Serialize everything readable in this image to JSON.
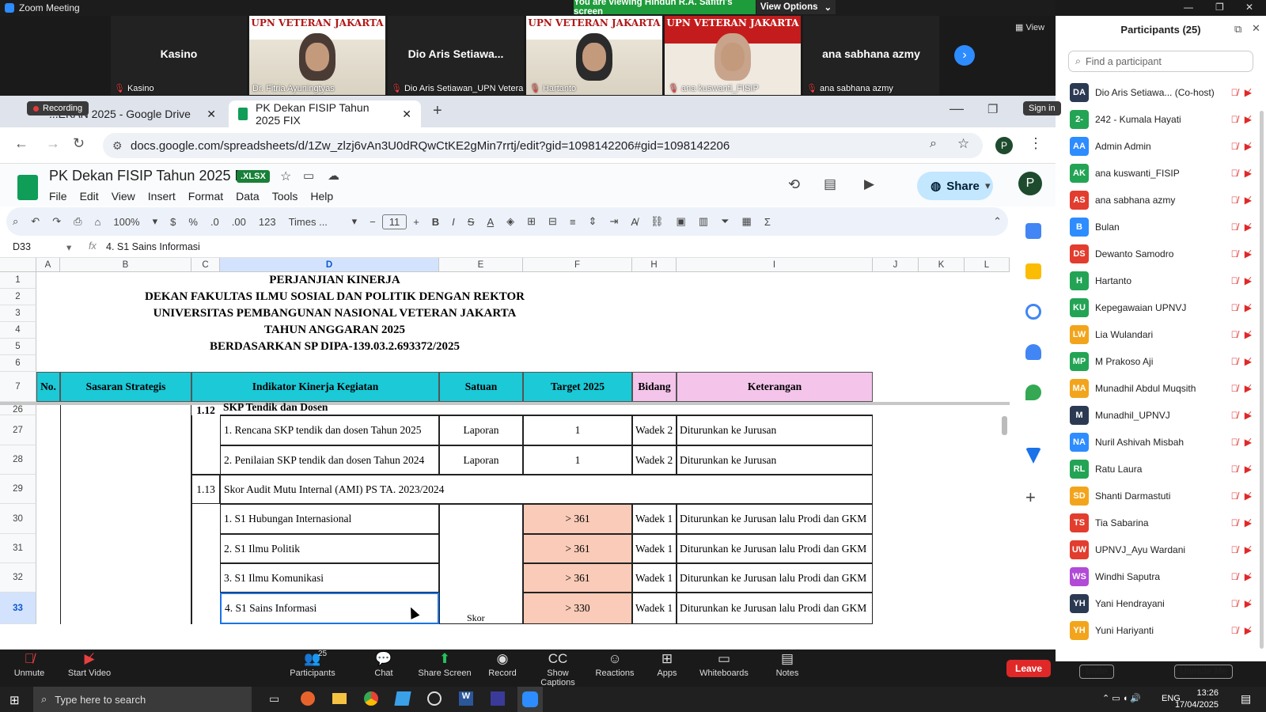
{
  "zoom": {
    "window_title": "Zoom Meeting",
    "viewing_banner": "You are viewing Hindun R.A. Safitri's screen",
    "view_options": "View Options",
    "view_label": "View",
    "recording_label": "Recording",
    "video_tiles": [
      {
        "type": "name",
        "name": "Kasino",
        "label": "Kasino"
      },
      {
        "type": "video",
        "banner": "UPN VETERAN JAKARTA",
        "label": "Dr. Fitria Ayuningtyas"
      },
      {
        "type": "name",
        "name": "Dio Aris Setiawa...",
        "label": "Dio Aris Setiawan_UPN Vetera..."
      },
      {
        "type": "video",
        "banner": "UPN VETERAN JAKARTA",
        "label": "Hartanto"
      },
      {
        "type": "video_red",
        "banner": "UPN VETERAN JAKARTA",
        "label": "ana kuswanti_FISIP"
      },
      {
        "type": "name",
        "name": "ana sabhana azmy",
        "label": "ana sabhana azmy"
      }
    ],
    "toolbar": [
      {
        "label": "Unmute",
        "icon": "mic-off-icon"
      },
      {
        "label": "Start Video",
        "icon": "video-off-icon"
      },
      {
        "label": "Participants",
        "icon": "participants-icon",
        "count": "25"
      },
      {
        "label": "Chat",
        "icon": "chat-icon"
      },
      {
        "label": "Share Screen",
        "icon": "share-screen-icon"
      },
      {
        "label": "Record",
        "icon": "record-icon"
      },
      {
        "label": "Show Captions",
        "icon": "captions-icon"
      },
      {
        "label": "Reactions",
        "icon": "reactions-icon"
      },
      {
        "label": "Apps",
        "icon": "apps-icon"
      },
      {
        "label": "Whiteboards",
        "icon": "whiteboard-icon"
      },
      {
        "label": "Notes",
        "icon": "notes-icon"
      }
    ],
    "leave_label": "Leave"
  },
  "participants": {
    "title": "Participants (25)",
    "search_placeholder": "Find a participant",
    "invite_label": "Invite",
    "unmute_me_label": "Unmute Me",
    "list": [
      {
        "initials": "DA",
        "name": "Dio Aris Setiawa... (Co-host)",
        "color": "#2b3a52"
      },
      {
        "initials": "2-",
        "name": "242 - Kumala Hayati",
        "color": "#23a455"
      },
      {
        "initials": "AA",
        "name": "Admin Admin",
        "color": "#2d8cff"
      },
      {
        "initials": "AK",
        "name": "ana kuswanti_FISIP",
        "color": "#23a455"
      },
      {
        "initials": "AS",
        "name": "ana sabhana azmy",
        "color": "#e23d2e"
      },
      {
        "initials": "B",
        "name": "Bulan",
        "color": "#2d8cff"
      },
      {
        "initials": "DS",
        "name": "Dewanto Samodro",
        "color": "#e23d2e"
      },
      {
        "initials": "H",
        "name": "Hartanto",
        "color": "#23a455"
      },
      {
        "initials": "KU",
        "name": "Kepegawaian UPNVJ",
        "color": "#23a455"
      },
      {
        "initials": "LW",
        "name": "Lia Wulandari",
        "color": "#f2a51c"
      },
      {
        "initials": "MP",
        "name": "M Prakoso Aji",
        "color": "#23a455"
      },
      {
        "initials": "MA",
        "name": "Munadhil Abdul Muqsith",
        "color": "#f2a51c"
      },
      {
        "initials": "M",
        "name": "Munadhil_UPNVJ",
        "color": "#2b3a52"
      },
      {
        "initials": "NA",
        "name": "Nuril Ashivah Misbah",
        "color": "#2d8cff"
      },
      {
        "initials": "RL",
        "name": "Ratu Laura",
        "color": "#23a455"
      },
      {
        "initials": "SD",
        "name": "Shanti Darmastuti",
        "color": "#f2a51c"
      },
      {
        "initials": "TS",
        "name": "Tia Sabarina",
        "color": "#e23d2e"
      },
      {
        "initials": "UW",
        "name": "UPNVJ_Ayu Wardani",
        "color": "#e23d2e"
      },
      {
        "initials": "WS",
        "name": "Windhi Saputra",
        "color": "#b14ad6"
      },
      {
        "initials": "YH",
        "name": "Yani Hendrayani",
        "color": "#2b3a52"
      },
      {
        "initials": "YH",
        "name": "Yuni Hariyanti",
        "color": "#f2a51c"
      }
    ]
  },
  "browser": {
    "tabs": [
      {
        "label": "...EKAN 2025 - Google Drive"
      },
      {
        "label": "PK Dekan FISIP Tahun 2025 FIX"
      }
    ],
    "url": "docs.google.com/spreadsheets/d/1Zw_zlzj6vAn3U0dRQwCtKE2gMin7rrtj/edit?gid=1098142206#gid=1098142206",
    "sign_in": "Sign in",
    "profile_initial": "P"
  },
  "sheets": {
    "doc_title": "PK Dekan FISIP Tahun 2025 FIX",
    "file_badge": ".XLSX",
    "menu": [
      "File",
      "Edit",
      "View",
      "Insert",
      "Format",
      "Data",
      "Tools",
      "Help"
    ],
    "share_label": "Share",
    "zoom_level": "100%",
    "font_name": "Times ...",
    "font_size": "11",
    "currency": "$",
    "percent": "%",
    "dec_dec": ".0",
    "dec_inc": ".00",
    "num_format": "123",
    "cell_ref": "D33",
    "formula": "4. S1 Sains Informasi",
    "columns": [
      "A",
      "B",
      "C",
      "D",
      "E",
      "F",
      "H",
      "I",
      "J",
      "K",
      "L"
    ],
    "title_lines": [
      "PERJANJIAN KINERJA",
      "DEKAN FAKULTAS ILMU SOSIAL DAN POLITIK DENGAN REKTOR",
      "UNIVERSITAS PEMBANGUNAN NASIONAL VETERAN JAKARTA",
      "TAHUN ANGGARAN 2025",
      "BERDASARKAN SP DIPA-139.03.2.693372/2025"
    ],
    "header": {
      "no": "No.",
      "sasaran": "Sasaran Strategis",
      "indikator": "Indikator Kinerja Kegiatan",
      "satuan": "Satuan",
      "target": "Target 2025",
      "bidang": "Bidang",
      "keterangan": "Keterangan"
    },
    "row_numbers": [
      "1",
      "2",
      "3",
      "4",
      "5",
      "6",
      "7",
      "26",
      "27",
      "28",
      "29",
      "30",
      "31",
      "32",
      "33"
    ],
    "rows": [
      {
        "c": "1.12",
        "d": "SKP Tendik dan Dosen"
      },
      {
        "c": "",
        "d": "1. Rencana SKP tendik dan dosen Tahun 2025",
        "e": "Laporan",
        "f": "1",
        "h": "Wadek 2",
        "i": "Diturunkan ke Jurusan"
      },
      {
        "c": "",
        "d": "2. Penilaian SKP tendik dan dosen Tahun 2024",
        "e": "Laporan",
        "f": "1",
        "h": "Wadek 2",
        "i": "Diturunkan ke Jurusan"
      },
      {
        "c": "1.13",
        "d": "Skor Audit Mutu Internal (AMI) PS TA. 2023/2024"
      },
      {
        "c": "",
        "d": "1. S1 Hubungan Internasional",
        "e": "",
        "f": "> 361",
        "h": "Wadek 1",
        "i": "Diturunkan ke Jurusan lalu Prodi dan GKM"
      },
      {
        "c": "",
        "d": "2. S1 Ilmu Politik",
        "e": "",
        "f": "> 361",
        "h": "Wadek 1",
        "i": "Diturunkan ke Jurusan lalu Prodi dan GKM"
      },
      {
        "c": "",
        "d": "3. S1 Ilmu Komunikasi",
        "e": "",
        "f": "> 361",
        "h": "Wadek 1",
        "i": "Diturunkan ke Jurusan lalu Prodi dan GKM"
      },
      {
        "c": "",
        "d": "4. S1 Sains Informasi",
        "e": "Skor",
        "f": "> 330",
        "h": "Wadek 1",
        "i": "Diturunkan ke Jurusan lalu Prodi dan GKM"
      }
    ]
  },
  "taskbar": {
    "search_placeholder": "Type here to search",
    "time": "13:26",
    "date": "17/04/2025",
    "lang": "ENG"
  }
}
